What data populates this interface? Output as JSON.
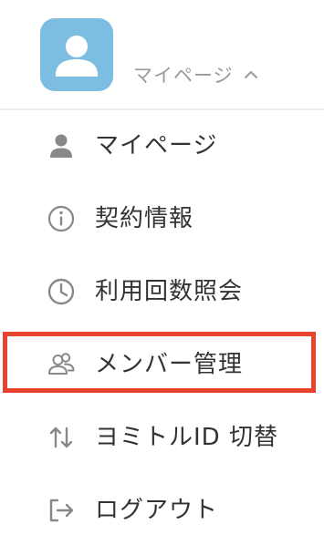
{
  "header": {
    "account_label": "マイページ",
    "avatar_color": "#7dbde2"
  },
  "menu": {
    "items": [
      {
        "label": "マイページ",
        "icon": "person-icon"
      },
      {
        "label": "契約情報",
        "icon": "info-icon"
      },
      {
        "label": "利用回数照会",
        "icon": "clock-icon"
      },
      {
        "label": "メンバー管理",
        "icon": "members-icon"
      },
      {
        "label": "ヨミトルID 切替",
        "icon": "swap-arrows-icon"
      },
      {
        "label": "ログアウト",
        "icon": "logout-icon"
      }
    ],
    "highlighted_item": "メンバー管理",
    "highlight_color": "#e8432d"
  }
}
